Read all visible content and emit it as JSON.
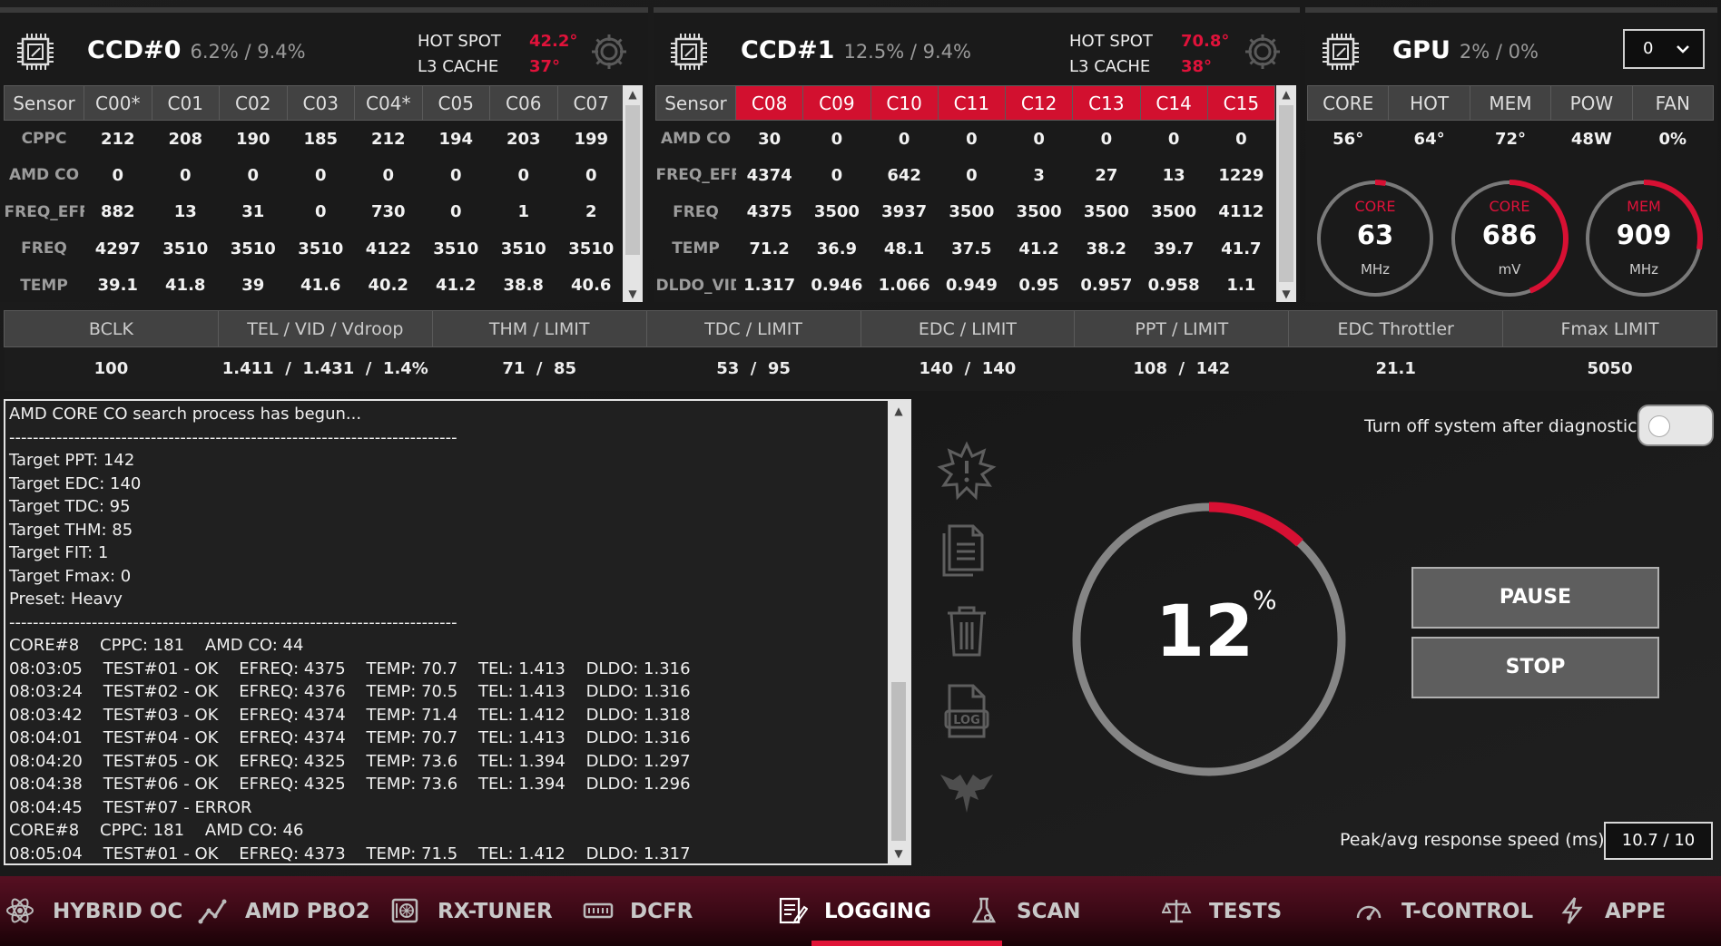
{
  "ccd0": {
    "title": "CCD#0",
    "load": "6.2% / 9.4%",
    "hotspot_label": "HOT SPOT",
    "hotspot_value": "42.2°",
    "l3_label": "L3 CACHE",
    "l3_value": "37°",
    "headers": [
      "Sensor",
      "C00*",
      "C01",
      "C02",
      "C03",
      "C04*",
      "C05",
      "C06",
      "C07"
    ],
    "rows": [
      {
        "label": "CPPC",
        "values": [
          "212",
          "208",
          "190",
          "185",
          "212",
          "194",
          "203",
          "199"
        ]
      },
      {
        "label": "AMD CO",
        "values": [
          "0",
          "0",
          "0",
          "0",
          "0",
          "0",
          "0",
          "0"
        ]
      },
      {
        "label": "FREQ_EFF",
        "values": [
          "882",
          "13",
          "31",
          "0",
          "730",
          "0",
          "1",
          "2"
        ]
      },
      {
        "label": "FREQ",
        "values": [
          "4297",
          "3510",
          "3510",
          "3510",
          "4122",
          "3510",
          "3510",
          "3510"
        ]
      },
      {
        "label": "TEMP",
        "values": [
          "39.1",
          "41.8",
          "39",
          "41.6",
          "40.2",
          "41.2",
          "38.8",
          "40.6"
        ]
      }
    ]
  },
  "ccd1": {
    "title": "CCD#1",
    "load": "12.5% / 9.4%",
    "hotspot_label": "HOT SPOT",
    "hotspot_value": "70.8°",
    "l3_label": "L3 CACHE",
    "l3_value": "38°",
    "headers": [
      "Sensor",
      "C08",
      "C09",
      "C10",
      "C11",
      "C12",
      "C13",
      "C14",
      "C15"
    ],
    "rows": [
      {
        "label": "AMD CO",
        "values": [
          "30",
          "0",
          "0",
          "0",
          "0",
          "0",
          "0",
          "0"
        ]
      },
      {
        "label": "FREQ_EFF",
        "values": [
          "4374",
          "0",
          "642",
          "0",
          "3",
          "27",
          "13",
          "1229"
        ]
      },
      {
        "label": "FREQ",
        "values": [
          "4375",
          "3500",
          "3937",
          "3500",
          "3500",
          "3500",
          "3500",
          "4112"
        ]
      },
      {
        "label": "TEMP",
        "values": [
          "71.2",
          "36.9",
          "48.1",
          "37.5",
          "41.2",
          "38.2",
          "39.7",
          "41.7"
        ]
      },
      {
        "label": "DLDO_VID",
        "values": [
          "1.317",
          "0.946",
          "1.066",
          "0.949",
          "0.95",
          "0.957",
          "0.958",
          "1.1"
        ]
      }
    ]
  },
  "gpu": {
    "title": "GPU",
    "load": "2% / 0%",
    "select_value": "0",
    "headers": [
      "CORE",
      "HOT",
      "MEM",
      "POW",
      "FAN"
    ],
    "values": [
      "56°",
      "64°",
      "72°",
      "48W",
      "0%"
    ],
    "gauges": [
      {
        "label": "CORE",
        "value": "63",
        "unit": "MHz",
        "fraction": 0.03
      },
      {
        "label": "CORE",
        "value": "686",
        "unit": "mV",
        "fraction": 0.44
      },
      {
        "label": "MEM",
        "value": "909",
        "unit": "MHz",
        "fraction": 0.28
      }
    ]
  },
  "stats": {
    "headers": [
      "BCLK",
      "TEL / VID / Vdroop",
      "THM / LIMIT",
      "TDC / LIMIT",
      "EDC / LIMIT",
      "PPT / LIMIT",
      "EDC Throttler",
      "Fmax LIMIT"
    ],
    "values": [
      "100",
      "1.411  /  1.431  /  1.4%",
      "71  /  85",
      "53  /  95",
      "140  /  140",
      "108  /  142",
      "21.1",
      "5050"
    ]
  },
  "log": {
    "lines": [
      "AMD CORE CO search process has begun...",
      "----------------------------------------------------------------------------",
      "Target PPT: 142",
      "Target EDC: 140",
      "Target TDC: 95",
      "Target THM: 85",
      "Target FIT: 1",
      "Target Fmax: 0",
      "Preset: Heavy",
      "----------------------------------------------------------------------------",
      "CORE#8    CPPC: 181    AMD CO: 44",
      "08:03:05    TEST#01 - OK    EFREQ: 4375    TEMP: 70.7    TEL: 1.413    DLDO: 1.316",
      "08:03:24    TEST#02 - OK    EFREQ: 4376    TEMP: 70.5    TEL: 1.413    DLDO: 1.316",
      "08:03:42    TEST#03 - OK    EFREQ: 4374    TEMP: 71.4    TEL: 1.412    DLDO: 1.318",
      "08:04:01    TEST#04 - OK    EFREQ: 4374    TEMP: 70.7    TEL: 1.413    DLDO: 1.316",
      "08:04:20    TEST#05 - OK    EFREQ: 4325    TEMP: 73.6    TEL: 1.394    DLDO: 1.297",
      "08:04:38    TEST#06 - OK    EFREQ: 4325    TEMP: 73.6    TEL: 1.394    DLDO: 1.296",
      "08:04:45    TEST#07 - ERROR",
      "CORE#8    CPPC: 181    AMD CO: 46",
      "08:05:04    TEST#01 - OK    EFREQ: 4373    TEMP: 71.5    TEL: 1.412    DLDO: 1.317"
    ]
  },
  "diagnostic": {
    "shutdown_label": "Turn off system after diagnostic",
    "shutdown_on": false,
    "progress_value": "12",
    "progress_unit": "%",
    "progress_fraction": 0.12,
    "pause_label": "PAUSE",
    "stop_label": "STOP",
    "response_label": "Peak/avg response speed (ms)",
    "response_value": "10.7 / 10"
  },
  "nav": {
    "items": [
      {
        "label": "HYBRID OC",
        "icon": "atom-icon"
      },
      {
        "label": "AMD PBO2",
        "icon": "chart-line-icon"
      },
      {
        "label": "RX-TUNER",
        "icon": "gpu-card-icon"
      },
      {
        "label": "DCFR",
        "icon": "memory-icon"
      },
      {
        "label": "LOGGING",
        "icon": "log-edit-icon",
        "active": true
      },
      {
        "label": "SCAN",
        "icon": "flask-icon"
      },
      {
        "label": "TESTS",
        "icon": "scales-icon"
      },
      {
        "label": "T-CONTROL",
        "icon": "gauge-icon"
      },
      {
        "label": "APPE",
        "icon": "lightning-icon"
      }
    ]
  },
  "colors": {
    "accent": "#e0123a",
    "panel": "#1a1a1a",
    "header": "#424242"
  }
}
